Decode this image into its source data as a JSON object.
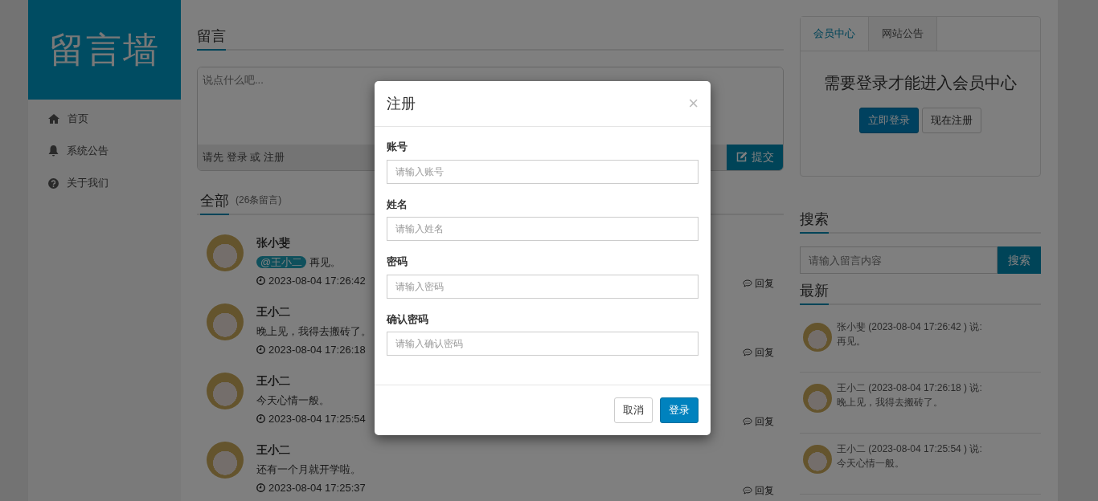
{
  "sidebar": {
    "logo": "留言墙",
    "items": [
      {
        "label": "首页"
      },
      {
        "label": "系统公告"
      },
      {
        "label": "关于我们"
      }
    ]
  },
  "compose": {
    "title": "留言",
    "placeholder": "说点什么吧...",
    "prompt": "请先",
    "login": "登录",
    "or": "或",
    "register": "注册",
    "submit": "提交"
  },
  "messages": {
    "title": "全部",
    "count": "(26条留言)",
    "items": [
      {
        "author": "张小斐",
        "mention": "@王小二",
        "text": "再见。",
        "time": "2023-08-04 17:26:42",
        "reply": "回复"
      },
      {
        "author": "王小二",
        "text": "晚上见，我得去搬砖了。",
        "time": "2023-08-04 17:26:18",
        "reply": "回复"
      },
      {
        "author": "王小二",
        "text": "今天心情一般。",
        "time": "2023-08-04 17:25:54",
        "reply": "回复"
      },
      {
        "author": "王小二",
        "text": "还有一个月就开学啦。",
        "time": "2023-08-04 17:25:37",
        "reply": "回复"
      }
    ]
  },
  "member": {
    "tabs": [
      {
        "label": "会员中心",
        "selected": true
      },
      {
        "label": "网站公告",
        "selected": false
      }
    ],
    "message": "需要登录才能进入会员中心",
    "login": "立即登录",
    "register": "现在注册"
  },
  "search": {
    "title": "搜索",
    "placeholder": "请输入留言内容",
    "button": "搜索"
  },
  "latest": {
    "title": "最新",
    "items": [
      {
        "header": "张小斐 (2023-08-04 17:26:42 ) 说:",
        "text": "再见。"
      },
      {
        "header": "王小二 (2023-08-04 17:26:18 ) 说:",
        "text": "晚上见，我得去搬砖了。"
      },
      {
        "header": "王小二 (2023-08-04 17:25:54 ) 说:",
        "text": "今天心情一般。"
      }
    ]
  },
  "modal": {
    "title": "注册",
    "close": "×",
    "fields": [
      {
        "label": "账号",
        "placeholder": "请输入账号"
      },
      {
        "label": "姓名",
        "placeholder": "请输入姓名"
      },
      {
        "label": "密码",
        "placeholder": "请输入密码"
      },
      {
        "label": "确认密码",
        "placeholder": "请输入确认密码"
      }
    ],
    "buttons": [
      {
        "label": "取消",
        "kind": "secondary"
      },
      {
        "label": "登录",
        "kind": "primary"
      }
    ]
  }
}
